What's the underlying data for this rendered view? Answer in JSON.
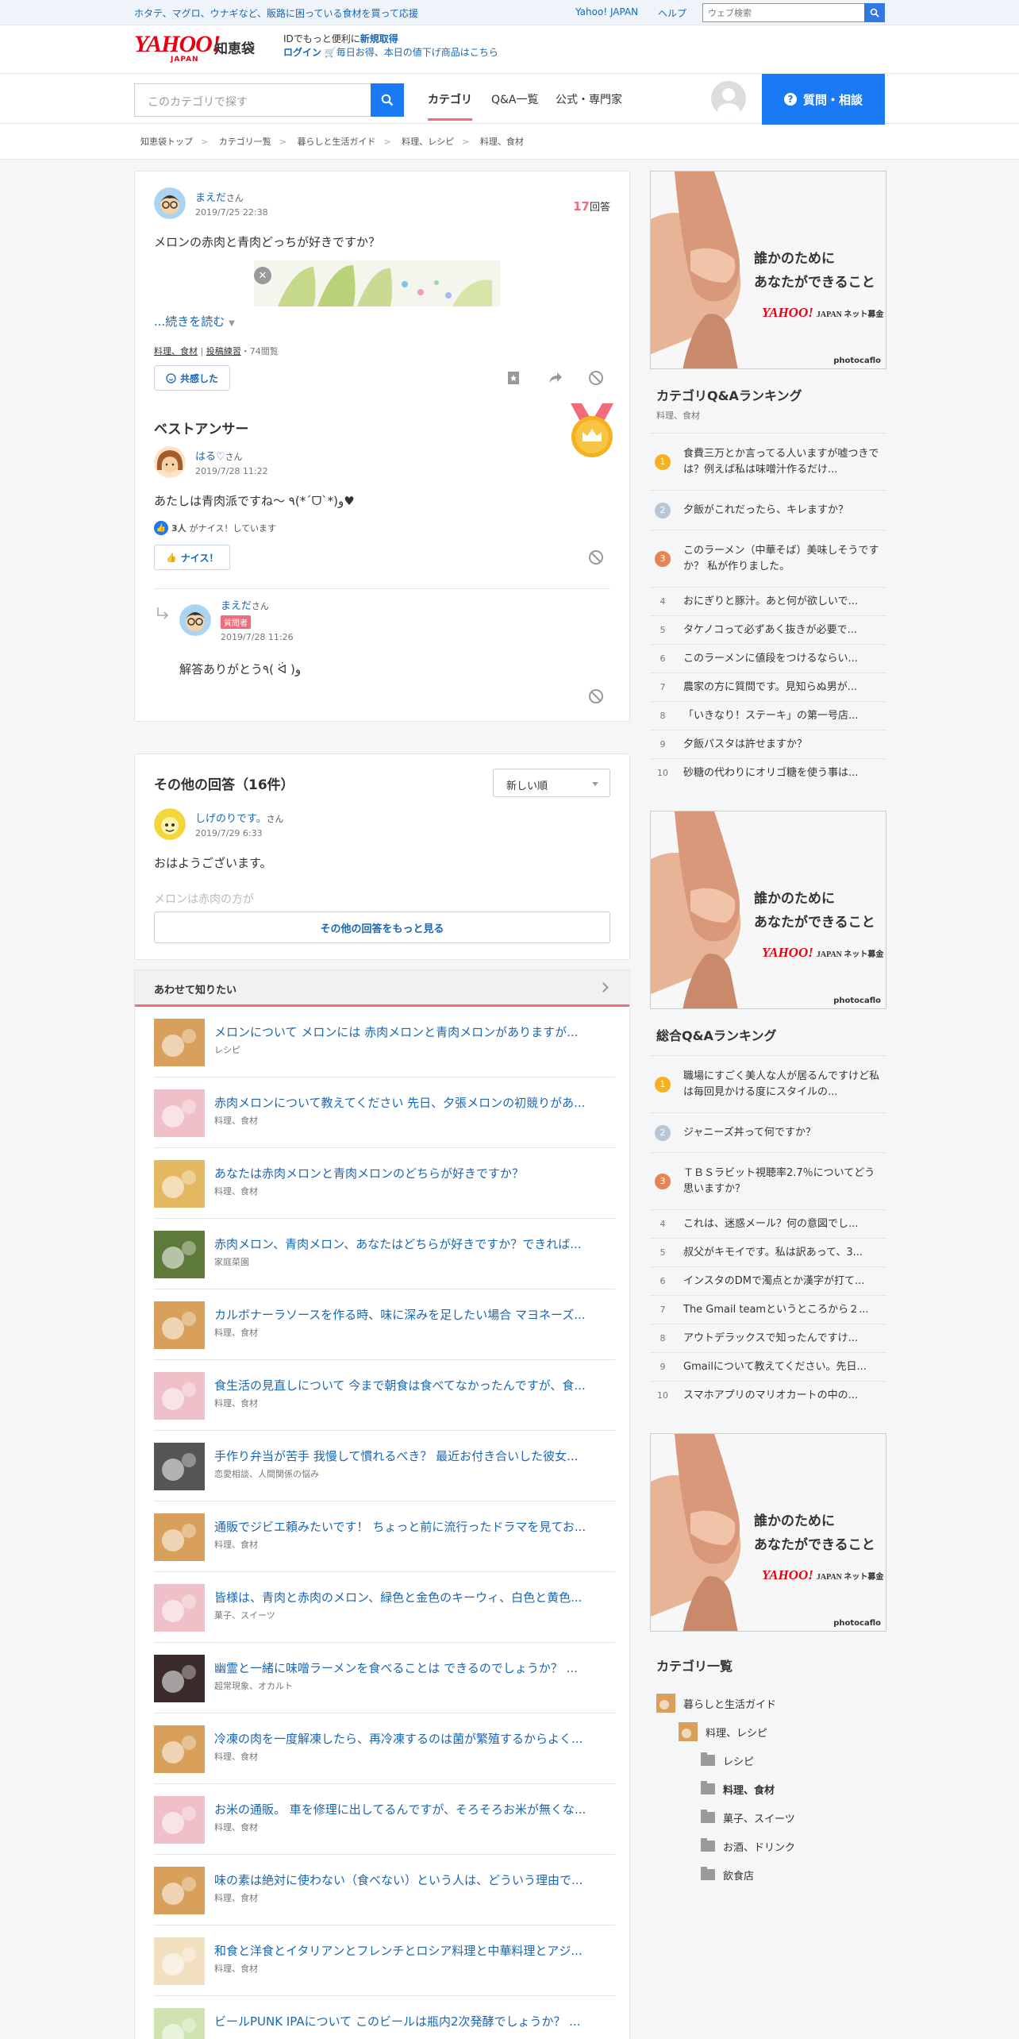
{
  "topbar": {
    "promo": "ホタテ、マグロ、ウナギなど、販路に困っている食材を買って応援",
    "links": [
      "Yahoo! JAPAN",
      "ヘルプ"
    ],
    "search_placeholder": "ウェブ検索"
  },
  "header": {
    "logo": "YAHOO!",
    "logo_sub": "JAPAN",
    "service": "知恵袋",
    "id_line_prefix": "IDでもっと便利に",
    "id_line_link": "新規取得",
    "login": "ログイン",
    "promo2": "毎日お得、本日の値下げ商品はこちら"
  },
  "nav": {
    "search_placeholder": "このカテゴリで探す",
    "tabs": [
      "カテゴリ",
      "Q&A一覧",
      "公式・専門家"
    ],
    "ask_button": "質問・相談"
  },
  "breadcrumb": [
    "知恵袋トップ",
    "カテゴリ一覧",
    "暮らしと生活ガイド",
    "料理、レシピ",
    "料理、食材"
  ],
  "question": {
    "user": "まえだ",
    "honorific": "さん",
    "date": "2019/7/25 22:38",
    "answer_count": "17",
    "answer_label": "回答",
    "text": "メロンの赤肉と青肉どっちが好きですか？",
    "read_more": "...続きを読む",
    "category_link": "料理、食材",
    "tag_link": "投稿練習",
    "views": "・74閲覧",
    "empathy_button": "共感した"
  },
  "best_answer": {
    "title": "ベストアンサー",
    "user": "はる♡",
    "honorific": "さん",
    "date": "2019/7/28 11:22",
    "text": "あたしは青肉派ですね〜 ٩(*ˊᗜˋ*)و♥",
    "nice_count": "3人",
    "nice_suffix": "がナイス！しています",
    "nice_button": "ナイス！",
    "reply": {
      "user": "まえだ",
      "honorific": "さん",
      "badge": "質問者",
      "date": "2019/7/28 11:26",
      "text": "解答ありがとう٩( ᐛ )و"
    }
  },
  "other_answers": {
    "title": "その他の回答（16件）",
    "sort": "新しい順",
    "first": {
      "user": "しげのりです。",
      "honorific": "さん",
      "date": "2019/7/29 6:33",
      "text": "おはようございます。",
      "fade_text": "メロンは赤肉の方が"
    },
    "more_button": "その他の回答をもっと見る"
  },
  "related": {
    "title": "あわせて知りたい",
    "items": [
      {
        "title": "メロンについて メロンには 赤肉メロンと青肉メロンがありますが...",
        "cat": "レシピ"
      },
      {
        "title": "赤肉メロンについて教えてください 先日、夕張メロンの初競りがあ...",
        "cat": "料理、食材"
      },
      {
        "title": "あなたは赤肉メロンと青肉メロンのどちらが好きですか？",
        "cat": "料理、食材"
      },
      {
        "title": "赤肉メロン、青肉メロン、あなたはどちらが好きですか？できれば...",
        "cat": "家庭菜園"
      },
      {
        "title": "カルボナーラソースを作る時、味に深みを足したい場合 マヨネーズ...",
        "cat": "料理、食材"
      },
      {
        "title": "食生活の見直しについて 今まで朝食は食べてなかったんですが、食...",
        "cat": "料理、食材"
      },
      {
        "title": "手作り弁当が苦手 我慢して慣れるべき？ 最近お付き合いした彼女...",
        "cat": "恋愛相談、人間関係の悩み"
      },
      {
        "title": "通販でジビエ頼みたいです！ ちょっと前に流行ったドラマを見てお...",
        "cat": "料理、食材"
      },
      {
        "title": "皆様は、青肉と赤肉のメロン、緑色と金色のキーウィ、白色と黄色...",
        "cat": "菓子、スイーツ"
      },
      {
        "title": "幽霊と一緒に味噌ラーメンを食べることは できるのでしょうか？ ...",
        "cat": "超常現象、オカルト"
      },
      {
        "title": "冷凍の肉を一度解凍したら、再冷凍するのは菌が繁殖するからよく...",
        "cat": "料理、食材"
      },
      {
        "title": "お米の通販。 車を修理に出してるんですが、そろそろお米が無くな...",
        "cat": "料理、食材"
      },
      {
        "title": "味の素は絶対に使わない（食べない）という人は、どういう理由で...",
        "cat": "料理、食材"
      },
      {
        "title": "和食と洋食とイタリアンとフレンチとロシア料理と中華料理とアジ...",
        "cat": "料理、食材"
      },
      {
        "title": "ビールPUNK IPAについて このビールは瓶内2次発酵でしょうか？ ...",
        "cat": ""
      }
    ]
  },
  "ad": {
    "line1": "誰かのために",
    "line2": "あなたができること",
    "brand": "YAHOO!",
    "brand_sub": "JAPAN ネット募金",
    "credit": "photocaflo"
  },
  "cat_ranking": {
    "title": "カテゴリQ&Aランキング",
    "subtitle": "料理、食材",
    "items": [
      "食費三万とか言ってる人いますが嘘つきでは？例えば私は味噌汁作るだけ...",
      "夕飯がこれだったら、キレますか？",
      "このラーメン（中華そば）美味しそうですか？ 私が作りました。",
      "おにぎりと豚汁。あと何が欲しいで...",
      "タケノコって必ずあく抜きが必要で...",
      "このラーメンに値段をつけるならい...",
      "農家の方に質問です。見知らぬ男が...",
      "「いきなり！ステーキ」の第一号店...",
      "夕飯パスタは許せますか？",
      "砂糖の代わりにオリゴ糖を使う事は..."
    ]
  },
  "all_ranking": {
    "title": "総合Q&Aランキング",
    "items": [
      "職場にすごく美人な人が居るんですけど私は毎回見かける度にスタイルの...",
      "ジャニーズ丼って何ですか？",
      "ＴＢＳラビット視聴率2.7％についてどう思いますか？",
      "これは、迷惑メール？何の意図でし...",
      "叔父がキモイです。私は訳あって、3...",
      "インスタのDMで濁点とか漢字が打て...",
      "The Gmail teamというところから２...",
      "アウトデラックスで知ったんですけ...",
      "Gmailについて教えてください。先日...",
      "スマホアプリのマリオカートの中の..."
    ]
  },
  "categories": {
    "title": "カテゴリ一覧",
    "items": [
      "暮らしと生活ガイド",
      "料理、レシピ",
      "レシピ",
      "料理、食材",
      "菓子、スイーツ",
      "お酒、ドリンク",
      "飲食店"
    ]
  },
  "colors": {
    "accent": "#1a79f5",
    "link": "#1a66b3",
    "tab_underline": "#f06c7a",
    "answer_count": "#f06c7a",
    "yahoo_red": "#e60012"
  }
}
